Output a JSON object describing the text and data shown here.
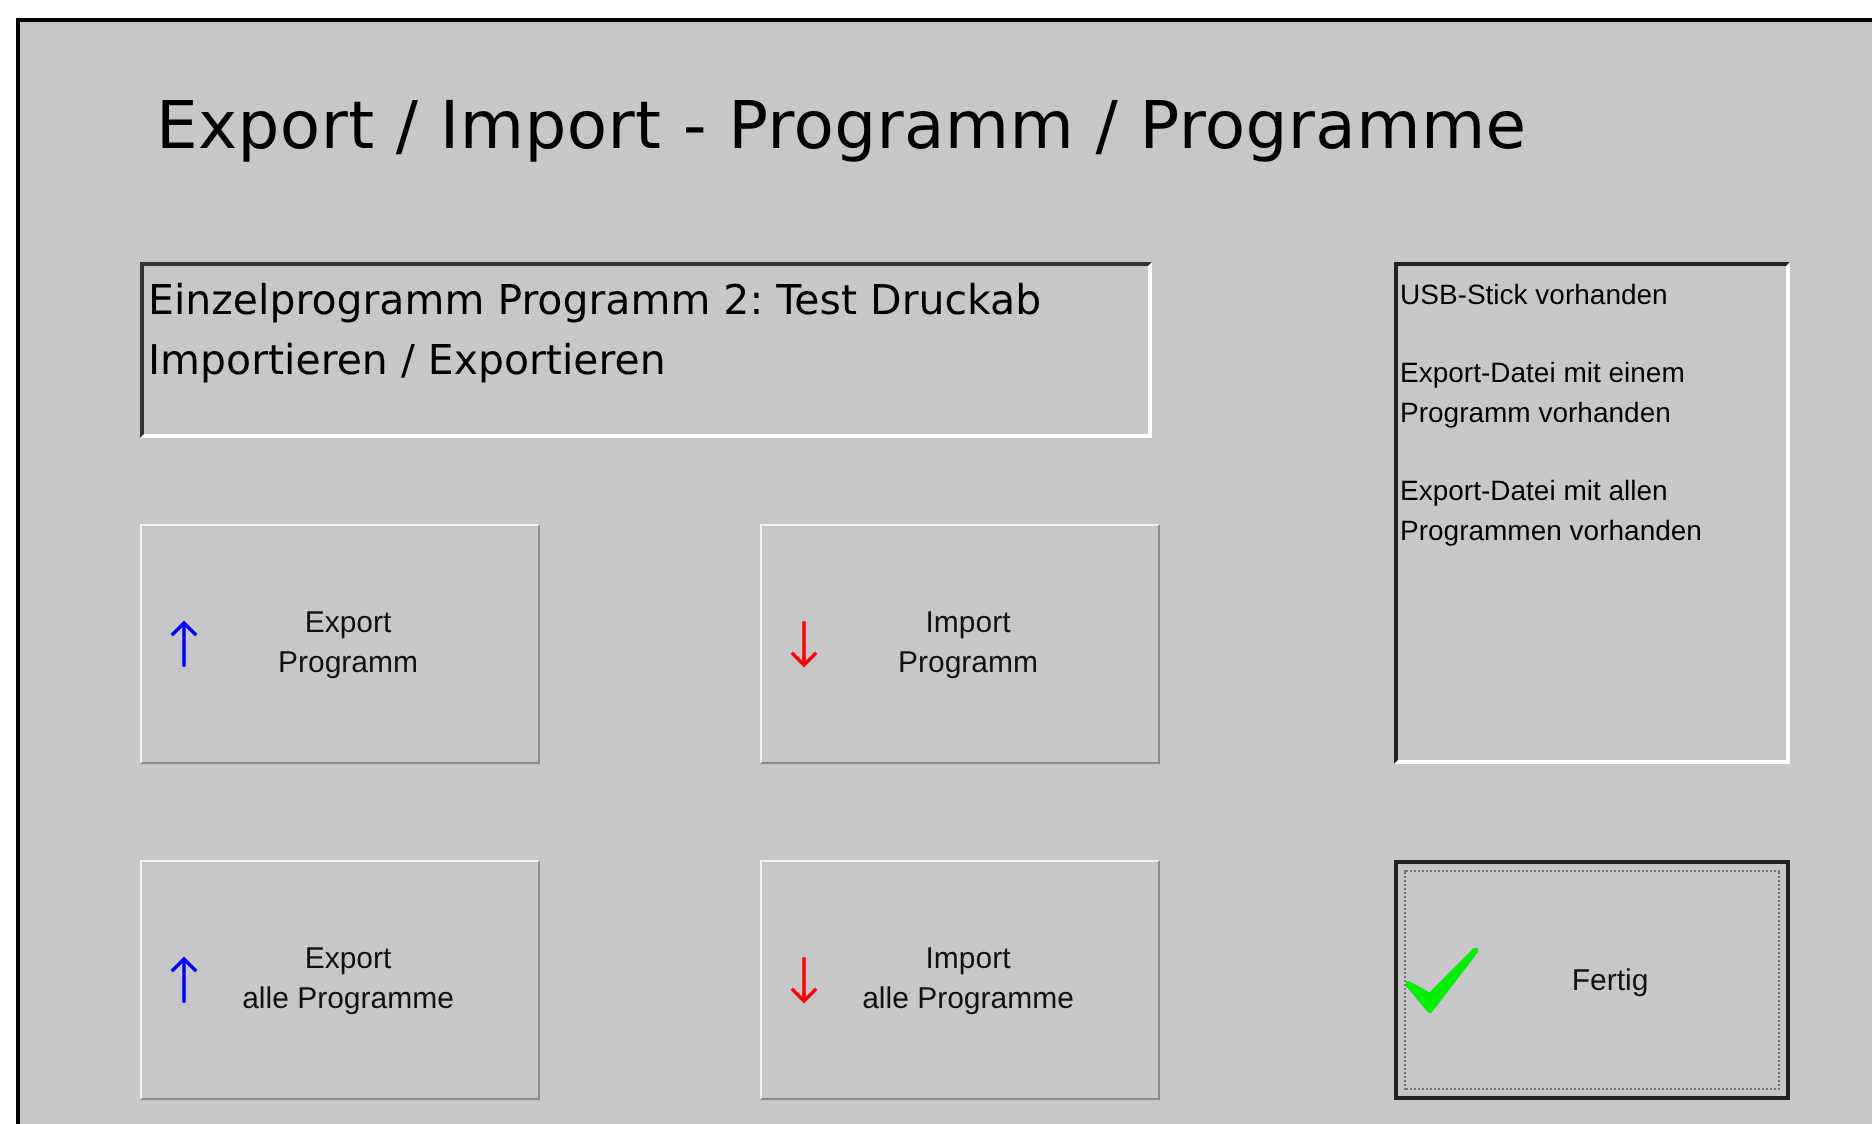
{
  "title": "Export / Import  -  Programm / Programme",
  "info": {
    "lines": [
      "Einzelprogramm Programm 2: Test Druckab",
      "Importieren / Exportieren"
    ]
  },
  "actions": [
    {
      "kind": "export",
      "lines": [
        "Export",
        "Programm"
      ]
    },
    {
      "kind": "import",
      "lines": [
        "Import",
        "Programm"
      ]
    },
    {
      "kind": "export",
      "lines": [
        "Export",
        "alle Programme"
      ]
    },
    {
      "kind": "import",
      "lines": [
        "Import",
        "alle Programme"
      ]
    }
  ],
  "status": {
    "messages": [
      "USB-Stick vorhanden",
      "Export-Datei mit einem Programm vorhanden",
      "Export-Datei mit allen Programmen vorhanden"
    ]
  },
  "done_button": {
    "label": "Fertig"
  }
}
